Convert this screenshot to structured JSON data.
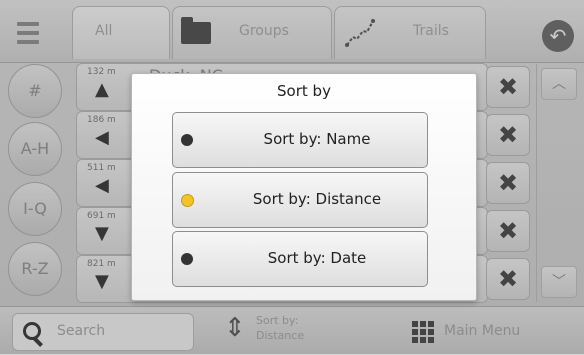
{
  "tabs": [
    {
      "label": "All"
    },
    {
      "label": "Groups"
    },
    {
      "label": "Trails"
    }
  ],
  "alpha_index": [
    "#",
    "A-H",
    "I-Q",
    "R-Z"
  ],
  "rows": [
    {
      "distance": "132 m",
      "name": "Duck, NC",
      "arrow": "▲"
    },
    {
      "distance": "186 m",
      "name": "",
      "arrow": "◀"
    },
    {
      "distance": "511 m",
      "name": "",
      "arrow": "◀"
    },
    {
      "distance": "691 m",
      "name": "",
      "arrow": "▼"
    },
    {
      "distance": "821 m",
      "name": "",
      "arrow": "▼"
    }
  ],
  "delete_glyph": "✖",
  "scroll": {
    "up": "︿",
    "down": "﹀"
  },
  "bottombar": {
    "search_placeholder": "Search",
    "sort_label_line1": "Sort by:",
    "sort_label_line2": "Distance",
    "main_menu_label": "Main Menu"
  },
  "dialog": {
    "title": "Sort by",
    "options": [
      {
        "label": "Sort by: Name",
        "selected": false
      },
      {
        "label": "Sort by: Distance",
        "selected": true
      },
      {
        "label": "Sort by: Date",
        "selected": false
      }
    ]
  },
  "colors": {
    "selected_dot": "#f2c42a",
    "unselected_dot": "#333333"
  }
}
